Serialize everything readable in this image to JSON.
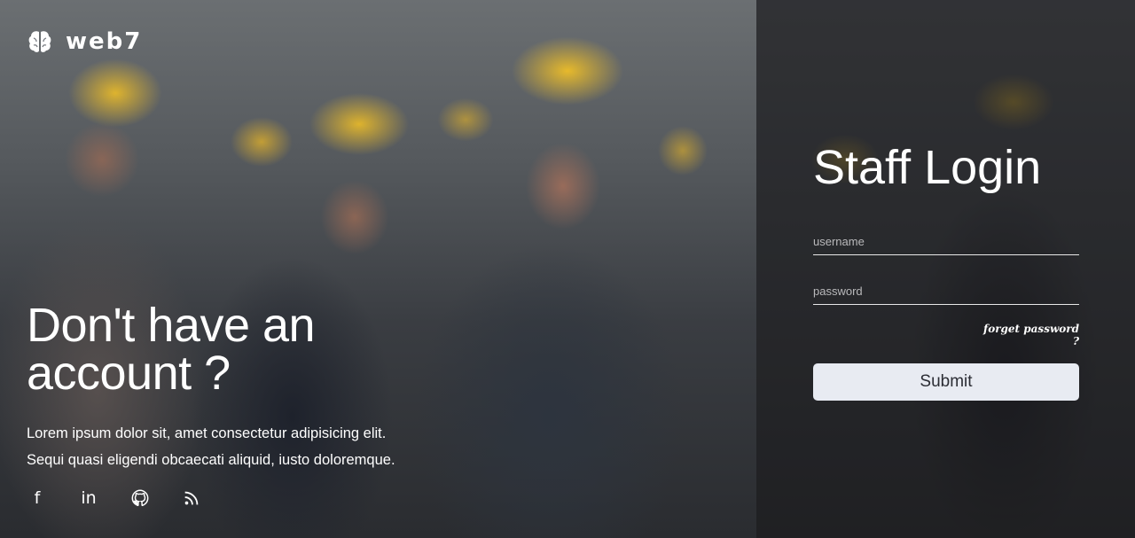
{
  "brand": {
    "name": "web7",
    "icon": "brain-icon"
  },
  "hero": {
    "title": "Don't have an account ?",
    "description": "Lorem ipsum dolor sit, amet consectetur adipisicing elit. Sequi quasi eligendi obcaecati aliquid, iusto doloremque."
  },
  "socials": [
    {
      "icon": "facebook-icon",
      "label": "f"
    },
    {
      "icon": "linkedin-icon",
      "label": "in"
    },
    {
      "icon": "github-icon"
    },
    {
      "icon": "rss-icon"
    }
  ],
  "login": {
    "title": "Staff Login",
    "username_placeholder": "username",
    "password_placeholder": "password",
    "forget_label": "forget password ?",
    "submit_label": "Submit"
  },
  "colors": {
    "submit_bg": "#e8ebf2",
    "text": "#ffffff",
    "helmet_yellow": "#eebe28"
  }
}
